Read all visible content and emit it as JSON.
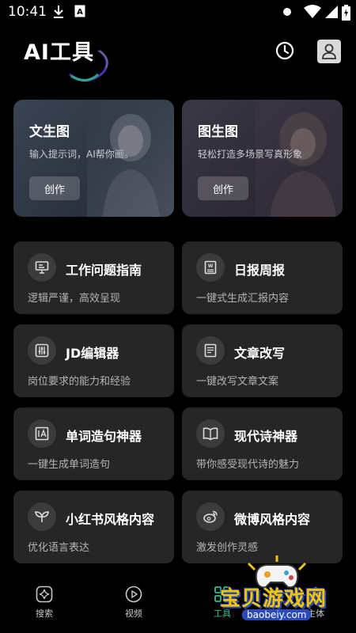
{
  "status_bar": {
    "time": "10:41"
  },
  "header": {
    "title": "AI工具"
  },
  "feature_cards": [
    {
      "title": "文生图",
      "desc": "输入提示词，AI帮你画。",
      "button": "创作"
    },
    {
      "title": "图生图",
      "desc": "轻松打造多场景写真形象",
      "button": "创作"
    }
  ],
  "tools": [
    {
      "title": "工作问题指南",
      "desc": "逻辑严谨，高效呈现",
      "icon": "monitor-icon"
    },
    {
      "title": "日报周报",
      "desc": "一键式生成汇报内容",
      "icon": "word-doc-icon"
    },
    {
      "title": "JD编辑器",
      "desc": "岗位要求的能力和经验",
      "icon": "sliders-icon"
    },
    {
      "title": "文章改写",
      "desc": "一键改写文章文案",
      "icon": "document-icon"
    },
    {
      "title": "单词造句神器",
      "desc": "一键生成单词造句",
      "icon": "text-box-icon"
    },
    {
      "title": "现代诗神器",
      "desc": "带你感受现代诗的魅力",
      "icon": "open-book-icon"
    },
    {
      "title": "小红书风格内容",
      "desc": "优化语言表达",
      "icon": "sprout-icon"
    },
    {
      "title": "微博风格内容",
      "desc": "激发创作灵感",
      "icon": "weibo-icon"
    }
  ],
  "bottom_nav": [
    {
      "label": "搜索",
      "icon": "sparkle-search-icon"
    },
    {
      "label": "视频",
      "icon": "play-circle-icon"
    },
    {
      "label": "工具",
      "icon": "grid-icon",
      "active": true
    },
    {
      "label": "主体",
      "icon": "person-icon"
    }
  ],
  "watermark": {
    "text": "宝贝游戏网",
    "domain": "baobeiy.com"
  },
  "colors": {
    "background": "#000000",
    "card": "#262626",
    "accent": "#27c48c"
  }
}
